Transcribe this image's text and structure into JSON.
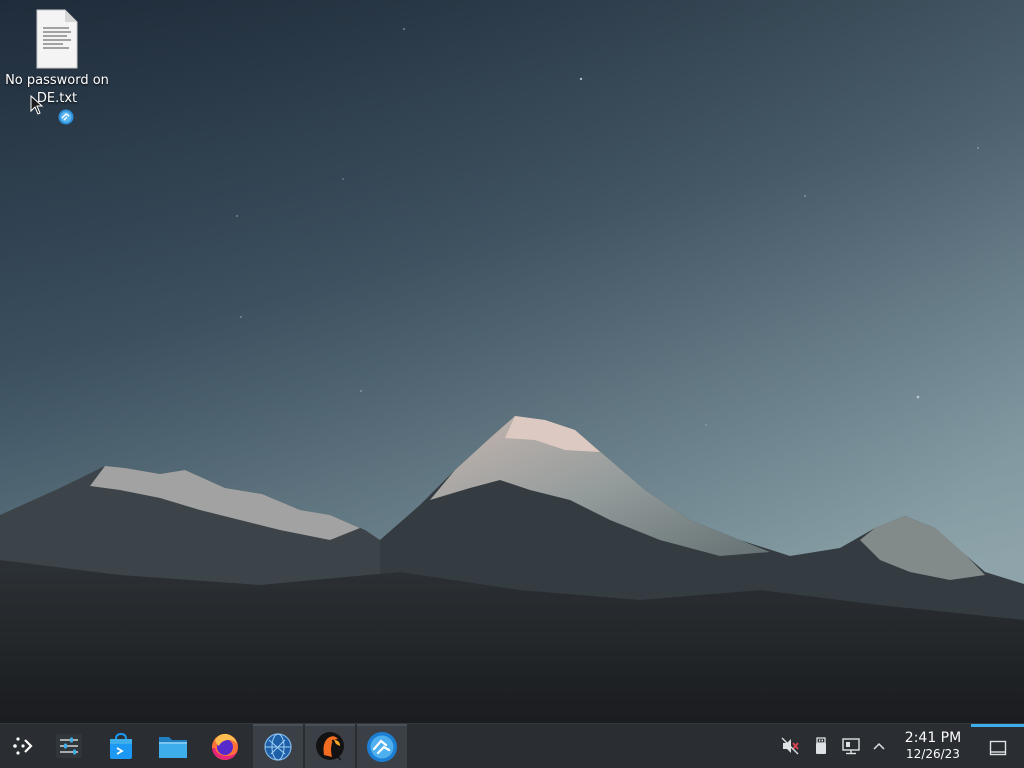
{
  "desktop": {
    "icons": [
      {
        "label": "No password on\nDE.txt",
        "icon": "text-file-icon",
        "emblem": "kde-connect-emblem-icon"
      }
    ]
  },
  "taskbar": {
    "launchers": [
      {
        "name": "application-launcher",
        "icon": "kde-launcher-icon",
        "active": false
      },
      {
        "name": "system-settings",
        "icon": "settings-sliders-icon",
        "active": false
      },
      {
        "name": "discover",
        "icon": "discover-store-icon",
        "active": false
      },
      {
        "name": "dolphin",
        "icon": "folder-icon",
        "active": false
      },
      {
        "name": "firefox",
        "icon": "firefox-icon",
        "active": false
      },
      {
        "name": "web-app",
        "icon": "globe-network-icon",
        "active": true
      },
      {
        "name": "chat-app",
        "icon": "parrot-chat-icon",
        "active": true
      },
      {
        "name": "connect-app",
        "icon": "kde-connect-icon",
        "active": true
      }
    ],
    "tray": {
      "icons": [
        "volume-muted-icon",
        "usb-device-icon",
        "network-wired-icon",
        "chevron-up-icon"
      ]
    },
    "clock": {
      "time": "2:41 PM",
      "date": "12/26/23"
    },
    "show_desktop": "show-desktop-icon"
  },
  "colors": {
    "panel": "#2a2e32",
    "accent": "#3daee9"
  }
}
